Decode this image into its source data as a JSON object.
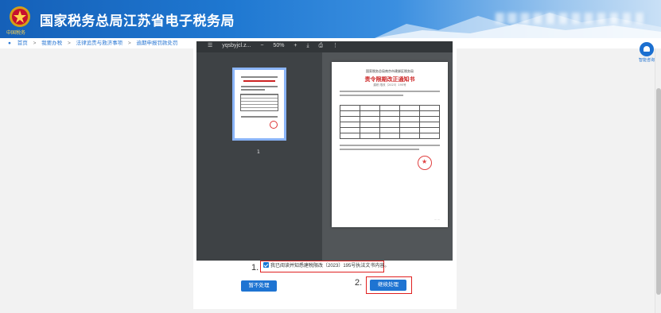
{
  "header": {
    "site_title": "国家税务总局江苏省电子税务局",
    "emblem_subtext": "中国税务"
  },
  "breadcrumb": {
    "items": [
      "首页",
      "我要办税",
      "法律追责与救济事项",
      "逾期申报罚款处罚"
    ],
    "separator": ">"
  },
  "helper": {
    "label": "智能咨询"
  },
  "pdf_viewer": {
    "file_name": "yqsbyjcl.z...",
    "zoom": "50%",
    "thumbnail_page_number": "1",
    "document": {
      "org": "国家税务总局南京市建邺区税务局",
      "title": "责令限期改正通知书",
      "doc_number": "建税 限改〔2023〕195号"
    }
  },
  "confirm": {
    "step_label": "1.",
    "text": "我已阅读并知悉建税限改〔2023〕195号执法文书内容。",
    "checked": true
  },
  "buttons": {
    "skip_label": "暂不处理",
    "step_label": "2.",
    "continue_label": "继续处理"
  },
  "colors": {
    "accent": "#1e74d2",
    "highlight": "#e02020"
  }
}
